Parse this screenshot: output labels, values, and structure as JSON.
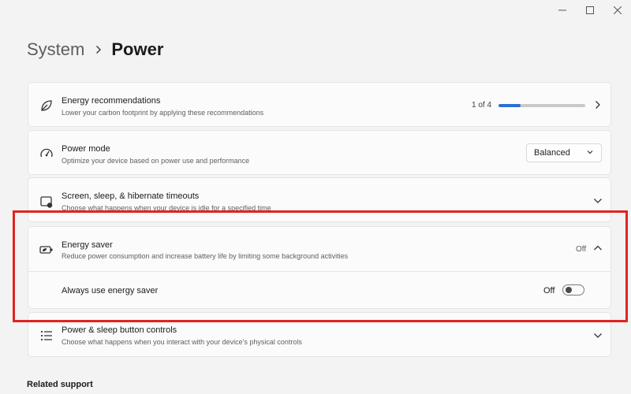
{
  "window": {
    "minimize_icon": "minimize-icon",
    "maximize_icon": "maximize-icon",
    "close_icon": "close-icon"
  },
  "breadcrumb": {
    "parent": "System",
    "current": "Power"
  },
  "energy_recommendations": {
    "title": "Energy recommendations",
    "description": "Lower your carbon footprint by applying these recommendations",
    "progress_text": "1 of 4",
    "progress_fraction": 0.25,
    "icon": "leaf-icon"
  },
  "power_mode": {
    "title": "Power mode",
    "description": "Optimize your device based on power use and performance",
    "selected": "Balanced",
    "icon": "gauge-icon"
  },
  "screen_sleep": {
    "title": "Screen, sleep, & hibernate timeouts",
    "description": "Choose what happens when your device is idle for a specified time",
    "icon": "screen-sleep-icon"
  },
  "energy_saver": {
    "title": "Energy saver",
    "description": "Reduce power consumption and increase battery life by limiting some background activities",
    "status": "Off",
    "icon": "battery-leaf-icon",
    "always_label": "Always use energy saver",
    "always_status": "Off",
    "always_on": false
  },
  "power_buttons": {
    "title": "Power & sleep button controls",
    "description": "Choose what happens when you interact with your device's physical controls",
    "icon": "list-settings-icon"
  },
  "related": {
    "label": "Related support"
  },
  "colors": {
    "accent": "#2d6fd6",
    "highlight": "#e0241f"
  }
}
